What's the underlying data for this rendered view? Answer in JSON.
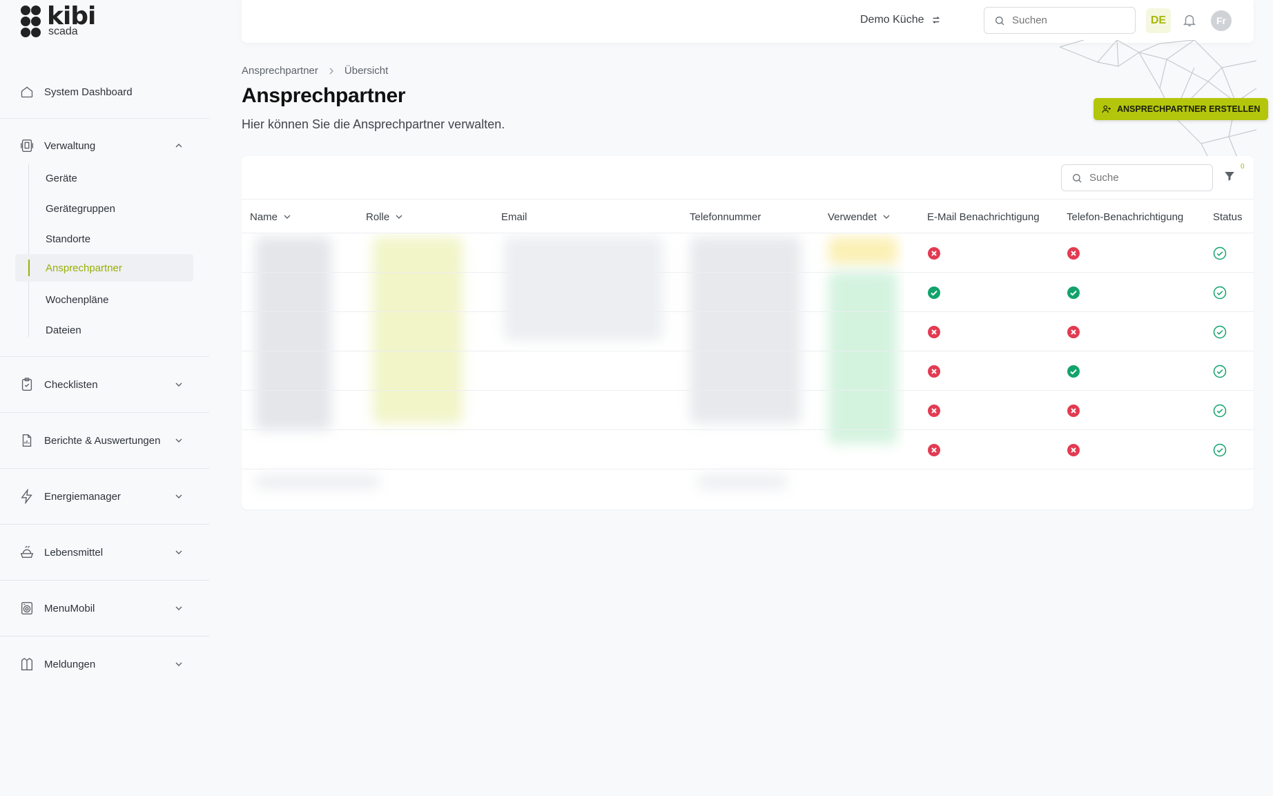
{
  "brand": {
    "name": "kibi",
    "sub": "scada"
  },
  "sidebar": {
    "dashboard": "System Dashboard",
    "verwaltung": {
      "label": "Verwaltung",
      "items": [
        "Geräte",
        "Gerätegruppen",
        "Standorte",
        "Ansprechpartner",
        "Wochenpläne",
        "Dateien"
      ],
      "active_index": 3
    },
    "sections": [
      "Checklisten",
      "Berichte & Auswertungen",
      "Energiemanager",
      "Lebensmittel",
      "MenuMobil",
      "Meldungen"
    ]
  },
  "header": {
    "tenant": "Demo Küche",
    "search_placeholder": "Suchen",
    "language": "DE",
    "avatar_initials": "Fr"
  },
  "page": {
    "breadcrumb": [
      "Ansprechpartner",
      "Übersicht"
    ],
    "title": "Ansprechpartner",
    "subtitle": "Hier können Sie die Ansprechpartner verwalten.",
    "create_button": "Ansprechpartner erstellen"
  },
  "table": {
    "search_placeholder": "Suche",
    "filter_count": "0",
    "columns": [
      "Name",
      "Rolle",
      "Email",
      "Telefonnummer",
      "Verwendet",
      "E-Mail Benachrichtigung",
      "Telefon-Benachrichtigung",
      "Status"
    ],
    "rows": [
      {
        "email_notification": false,
        "phone_notification": false,
        "status": true
      },
      {
        "email_notification": true,
        "phone_notification": true,
        "status": true
      },
      {
        "email_notification": false,
        "phone_notification": false,
        "status": true
      },
      {
        "email_notification": false,
        "phone_notification": true,
        "status": true
      },
      {
        "email_notification": false,
        "phone_notification": false,
        "status": true
      },
      {
        "email_notification": false,
        "phone_notification": false,
        "status": true
      }
    ]
  },
  "colors": {
    "accent": "#b4c60b",
    "yes": "#12a36b",
    "no": "#e23b52"
  }
}
